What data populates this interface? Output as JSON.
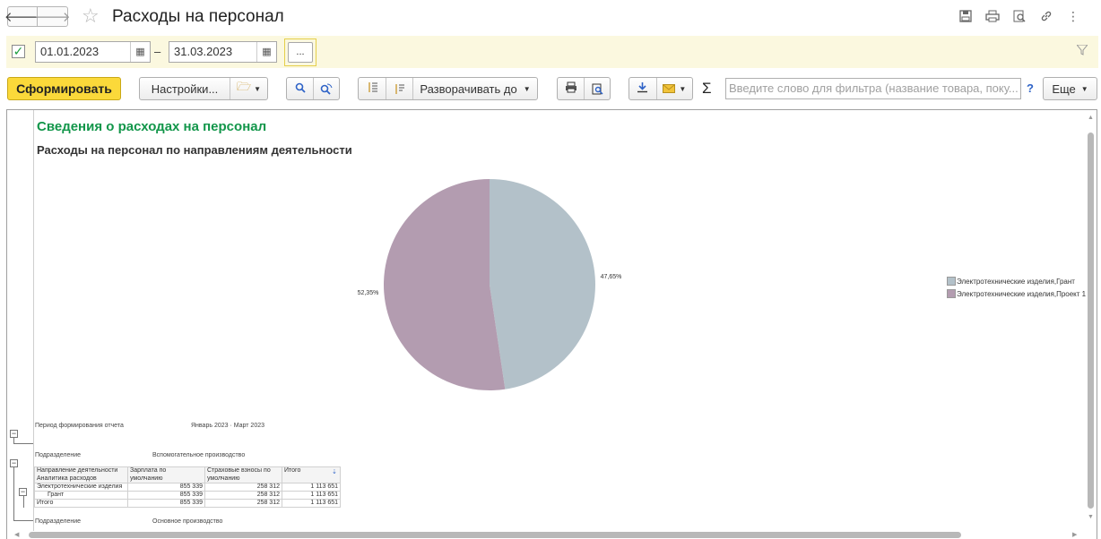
{
  "window": {
    "title": "Расходы на персонал"
  },
  "period": {
    "enabled": true,
    "from": "01.01.2023",
    "to": "31.03.2023",
    "separator": "–",
    "more_label": "..."
  },
  "toolbar": {
    "generate_label": "Сформировать",
    "settings_label": "Настройки...",
    "expand_label": "Разворачивать до",
    "search_placeholder": "Введите слово для фильтра (название товара, поку...",
    "help_label": "?",
    "more_label": "Еще",
    "sigma": "Σ"
  },
  "report": {
    "title": "Сведения о расходах на персонал",
    "subtitle": "Расходы на персонал по направлениям деятельности",
    "period_label": "Период формирования отчета",
    "period_value": "Январь 2023 · Март 2023",
    "dept_label": "Подразделение",
    "dept1_value": "Вспомогательное производство",
    "dept2_value": "Основное производство",
    "table": {
      "headers": [
        "Направление деятельности",
        "Зарплата по",
        "Страховые взносы по",
        "Итого"
      ],
      "headers2": [
        "Аналитика расходов",
        "умолчанию",
        "умолчанию",
        ""
      ],
      "rows": [
        [
          "Электротехнические изделия",
          "855 339",
          "258 312",
          "1 113 651"
        ],
        [
          "Грант",
          "855 339",
          "258 312",
          "1 113 651"
        ],
        [
          "Итого",
          "855 339",
          "258 312",
          "1 113 651"
        ]
      ]
    }
  },
  "chart_data": {
    "type": "pie",
    "title": "",
    "series": [
      {
        "name": "Электротехнические изделия,Грант",
        "value": 47.65,
        "label": "47,65%",
        "color": "#b3c1c9"
      },
      {
        "name": "Электротехнические изделия,Проект 1",
        "value": 52.35,
        "label": "52,35%",
        "color": "#b39cb0"
      }
    ],
    "legend_position": "right"
  }
}
